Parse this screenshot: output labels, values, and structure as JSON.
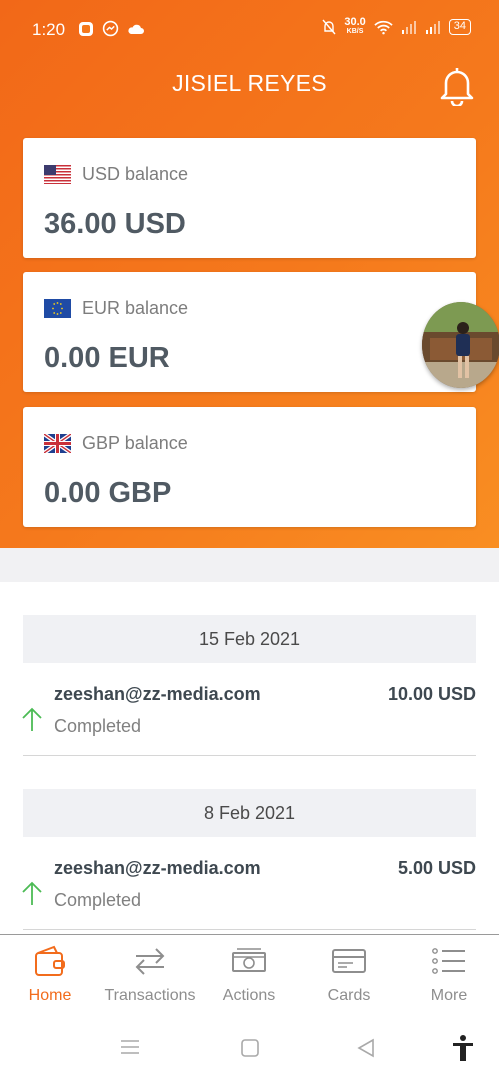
{
  "status_bar": {
    "time": "1:20",
    "net_speed_value": "30.0",
    "net_speed_unit": "KB/S",
    "battery": "34",
    "icons": [
      "app-notification-icon",
      "messenger-icon",
      "cloud-icon",
      "mute-icon",
      "wifi-icon",
      "signal-icon",
      "signal-icon",
      "battery-icon"
    ]
  },
  "header": {
    "title": "JISIEL REYES",
    "bell_icon": "bell-icon",
    "accent_color": "#f5781c"
  },
  "balances": [
    {
      "flag": "us-flag-icon",
      "label": "USD balance",
      "amount": "36.00 USD"
    },
    {
      "flag": "eu-flag-icon",
      "label": "EUR balance",
      "amount": "0.00 EUR"
    },
    {
      "flag": "uk-flag-icon",
      "label": "GBP balance",
      "amount": "0.00 GBP"
    }
  ],
  "transactions": [
    {
      "date": "15 Feb 2021",
      "email": "zeeshan@zz-media.com",
      "status": "Completed",
      "amount": "10.00 USD",
      "icon": "arrow-up-icon"
    },
    {
      "date": "8 Feb 2021",
      "email": "zeeshan@zz-media.com",
      "status": "Completed",
      "amount": "5.00 USD",
      "icon": "arrow-up-icon"
    }
  ],
  "bottom_nav": [
    {
      "label": "Home",
      "icon": "wallet-icon",
      "active": true
    },
    {
      "label": "Transactions",
      "icon": "transfer-arrows-icon",
      "active": false
    },
    {
      "label": "Actions",
      "icon": "cash-icon",
      "active": false
    },
    {
      "label": "Cards",
      "icon": "card-icon",
      "active": false
    },
    {
      "label": "More",
      "icon": "list-icon",
      "active": false
    }
  ],
  "system_nav": [
    "menu-icon",
    "home-square-icon",
    "back-triangle-icon",
    "accessibility-icon"
  ]
}
